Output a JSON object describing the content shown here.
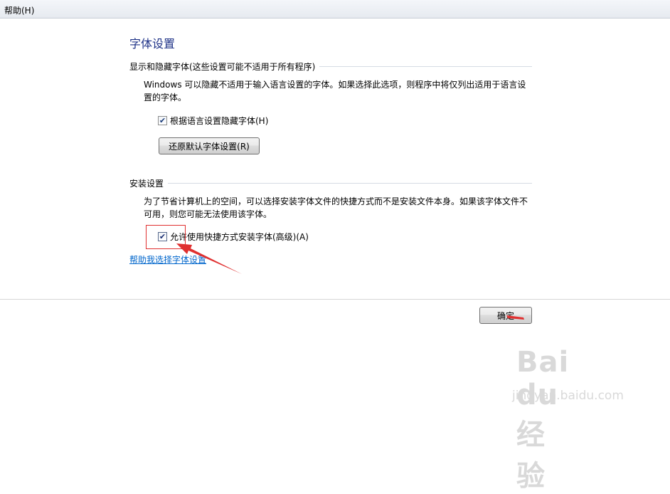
{
  "menubar": {
    "help": "帮助(H)"
  },
  "page_title": "字体设置",
  "show_hide": {
    "heading": "显示和隐藏字体(这些设置可能不适用于所有程序)",
    "desc_line1": "Windows 可以隐藏不适用于输入语言设置的字体。如果选择此选项，则程序中将仅列出适用于语言设",
    "desc_line2": "置的字体。",
    "checkbox_label": "根据语言设置隐藏字体(H)",
    "checkbox_checked": true,
    "restore_button": "还原默认字体设置(R)"
  },
  "install": {
    "heading": "安装设置",
    "desc_line1": "为了节省计算机上的空间，可以选择安装字体文件的快捷方式而不是安装文件本身。如果该字体文件不",
    "desc_line2": "可用，则您可能无法使用该字体。",
    "checkbox_label": "允许使用快捷方式安装字体(高级)(A)",
    "checkbox_checked": true
  },
  "help_link": "帮助我选择字体设置",
  "ok_button": "确定",
  "annotation_color": "#e03030",
  "watermark": {
    "logo": "Bai du 经验",
    "sub": "jingyan.baidu.com"
  }
}
